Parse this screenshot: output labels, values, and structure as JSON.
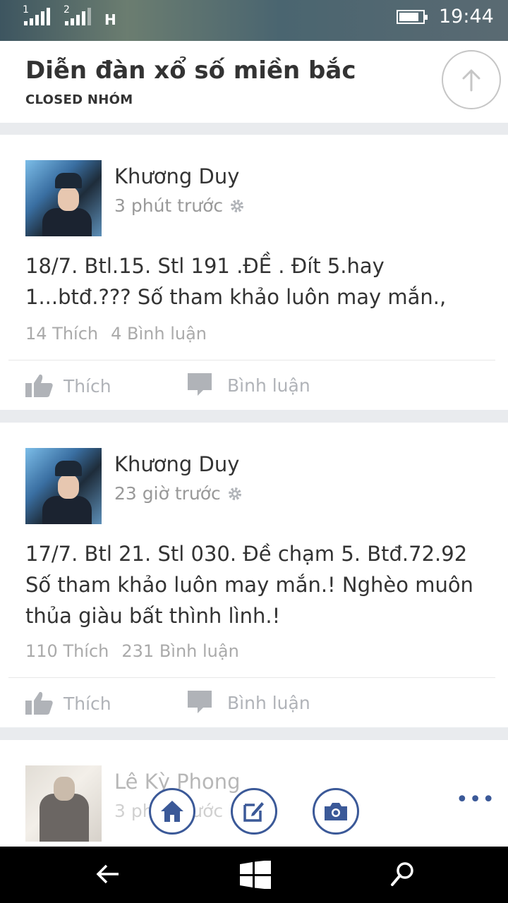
{
  "status_bar": {
    "sim1": "1",
    "sim2": "2",
    "network": "H",
    "battery_level": 0.85,
    "time": "19:44"
  },
  "header": {
    "title": "Diễn đàn xổ số miền bắc",
    "subtitle": "CLOSED NHÓM",
    "scroll_top_icon": "arrow-up-icon"
  },
  "posts": [
    {
      "author": "Khương Duy",
      "time": "3 phút trước",
      "text": "18/7. Btl.15. Stl 191 .ĐỀ . Đít 5.hay 1...btđ.??? Số tham khảo luôn may mắn.,",
      "likes": "14 Thích",
      "comments": "4 Bình luận",
      "like_label": "Thích",
      "comment_label": "Bình luận"
    },
    {
      "author": "Khương Duy",
      "time": "23 giờ trước",
      "text": "17/7. Btl 21. Stl 030. Đề chạm 5. Btđ.72.92 Số tham khảo luôn may mắn.! Nghèo muôn thủa giàu bất thình lình.!",
      "likes": "110 Thích",
      "comments": "231 Bình luận",
      "like_label": "Thích",
      "comment_label": "Bình luận"
    },
    {
      "author": "Lê Kỳ Phong",
      "time": "3 phút trước"
    }
  ],
  "bottom_bar": {
    "home_icon": "home-icon",
    "compose_icon": "compose-icon",
    "camera_icon": "camera-icon",
    "more_label": "•••"
  },
  "nav_bar": {
    "back_icon": "back-arrow-icon",
    "windows_icon": "windows-icon",
    "search_icon": "search-icon"
  },
  "colors": {
    "brand": "#3b5998",
    "muted": "#b0b3b8",
    "text": "#333333",
    "background": "#e9ebee"
  }
}
